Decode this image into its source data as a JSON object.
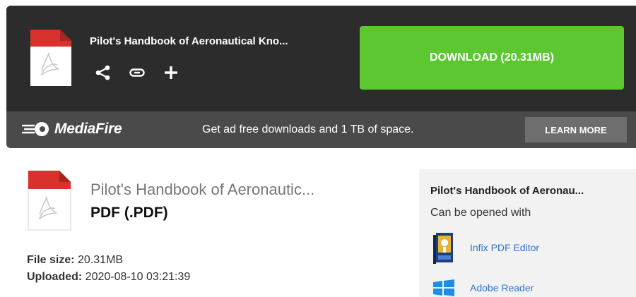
{
  "download_bar": {
    "file_title": "Pilot's Handbook of Aeronautical Kno...",
    "download_label": "DOWNLOAD (20.31MB)",
    "actions": [
      {
        "icon": "share-icon"
      },
      {
        "icon": "link-icon"
      },
      {
        "icon": "plus-icon"
      }
    ]
  },
  "promo": {
    "logo_text": "MediaFire",
    "message": "Get ad free downloads and 1 TB of space.",
    "learn_more_label": "LEARN MORE"
  },
  "file_info": {
    "name": "Pilot's Handbook of Aeronautic...",
    "type": "PDF (.PDF)",
    "size_label": "File size:",
    "size_value": "20.31MB",
    "uploaded_label": "Uploaded:",
    "uploaded_value": "2020-08-10 03:21:39"
  },
  "side_panel": {
    "title": "Pilot's Handbook of Aeronau...",
    "subtitle": "Can be opened with",
    "apps": [
      {
        "name": "Infix PDF Editor",
        "icon": "infix-pdf-editor-icon"
      },
      {
        "name": "Adobe Reader",
        "icon": "windows-icon"
      }
    ]
  },
  "colors": {
    "download_button": "#5cc731",
    "top_bar": "#2c2c2c",
    "promo_bar": "#4a4a4a",
    "link": "#2f74d0",
    "pdf_red": "#d9312b"
  }
}
